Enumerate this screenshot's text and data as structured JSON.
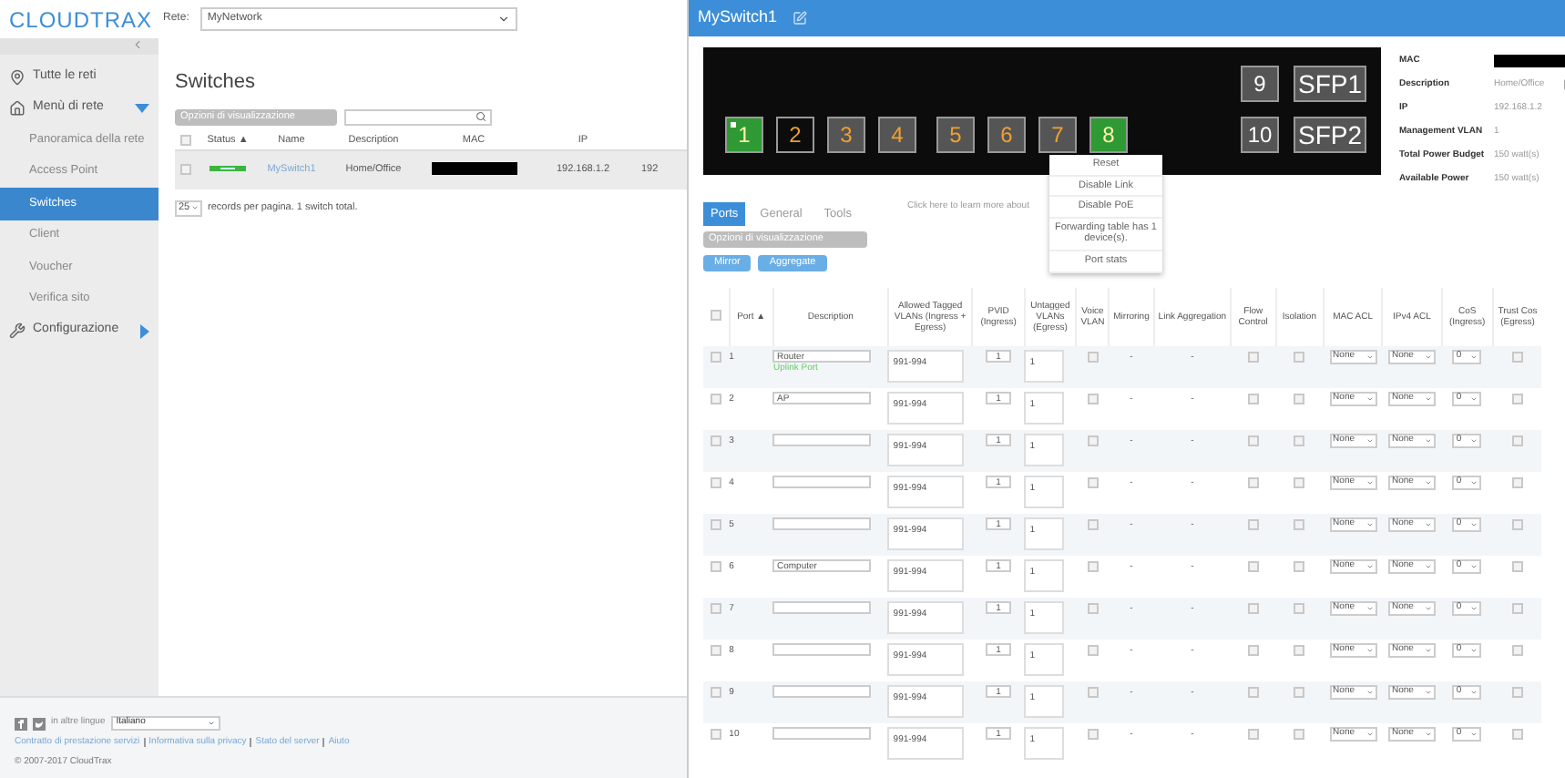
{
  "topbar": {
    "logo": "CLOUDTRAX",
    "network_label": "Rete:",
    "network": "MyNetwork"
  },
  "sidebar": {
    "items": [
      {
        "label": "Tutte le reti",
        "kind": "pin",
        "selected": false
      },
      {
        "label": "Menù di rete",
        "kind": "home",
        "expanded": true,
        "selected": false,
        "children": [
          {
            "label": "Panoramica della rete",
            "selected": false
          },
          {
            "label": "Access Point",
            "selected": false
          },
          {
            "label": "Switches",
            "selected": true
          },
          {
            "label": "Client",
            "selected": false
          },
          {
            "label": "Voucher",
            "selected": false
          },
          {
            "label": "Verifica sito",
            "selected": false
          }
        ]
      },
      {
        "label": "Configurazione",
        "kind": "wrench",
        "expanded": false,
        "selected": false
      }
    ]
  },
  "switches": {
    "title": "Switches",
    "options_button": "Opzioni di visualizzazione",
    "columns": [
      "Status ▲",
      "Name",
      "Description",
      "MAC",
      "IP"
    ],
    "all_checked": false,
    "rows": [
      {
        "checked": false,
        "name": "MySwitch1",
        "description": "Home/Office",
        "ip": "192.168.1.2",
        "column_6": "192"
      }
    ],
    "page_size": "25",
    "pager_text": "records per pagina. 1 switch total."
  },
  "footer": {
    "language_label": "in altre lingue",
    "language": "Italiano",
    "links": [
      "Contratto di prestazione servizi",
      "Informativa sulla privacy",
      "Stato del server",
      "Aiuto"
    ],
    "copyright": "© 2007-2017 CloudTrax"
  },
  "panel": {
    "title": "MySwitch1",
    "ports": [
      {
        "label": "1",
        "kind": "connected",
        "poe": true,
        "indicator": true
      },
      {
        "label": "2",
        "kind": "empty",
        "poe": true,
        "indicator": false
      },
      {
        "label": "3",
        "kind": "idle",
        "poe": true,
        "indicator": false
      },
      {
        "label": "4",
        "kind": "idle",
        "poe": true,
        "indicator": false
      },
      {
        "label": "5",
        "kind": "idle",
        "poe": true,
        "indicator": false
      },
      {
        "label": "6",
        "kind": "idle",
        "poe": true,
        "indicator": false
      },
      {
        "label": "7",
        "kind": "idle",
        "poe": true,
        "indicator": false
      },
      {
        "label": "8",
        "kind": "connected",
        "poe": true,
        "indicator": false
      }
    ],
    "upper_ports": [
      {
        "label": "9",
        "kind": "idle",
        "poe": false,
        "indicator": false
      },
      {
        "label": "SFP1",
        "kind": "idle",
        "poe": false,
        "indicator": false
      }
    ],
    "lower_ports": [
      {
        "label": "10",
        "kind": "idle",
        "poe": false,
        "indicator": false
      },
      {
        "label": "SFP2",
        "kind": "idle",
        "poe": false,
        "indicator": false
      }
    ],
    "learn_more": "Click here to learn more about",
    "context_menu": [
      "Reset",
      "Disable Link",
      "Disable PoE",
      "Forwarding table has 1 device(s).",
      "Port stats"
    ],
    "info": [
      {
        "label": "MAC",
        "kind": "redacted"
      },
      {
        "label": "Description",
        "value": "Home/Office",
        "kind": "editable"
      },
      {
        "label": "IP",
        "value": "192.168.1.2",
        "kind": "text"
      },
      {
        "label": "Management VLAN",
        "value": "1",
        "kind": "text"
      },
      {
        "label": "Total Power Budget",
        "value": "150 watt(s)",
        "kind": "text"
      },
      {
        "label": "Available Power",
        "value": "150 watt(s)",
        "kind": "text"
      }
    ],
    "tabs": [
      {
        "label": "Ports",
        "selected": true
      },
      {
        "label": "General",
        "selected": false
      },
      {
        "label": "Tools",
        "selected": false
      }
    ],
    "options_button": "Opzioni di visualizzazione",
    "buttons": [
      "Mirror",
      "Aggregate"
    ],
    "all_checked": false,
    "columns": [
      "Port ▲",
      "Description",
      "Allowed Tagged VLANs (Ingress + Egress)",
      "PVID (Ingress)",
      "Untagged VLANs (Egress)",
      "Voice VLAN",
      "Mirroring",
      "Link Aggregation",
      "Flow Control",
      "Isolation",
      "MAC ACL",
      "IPv4 ACL",
      "CoS (Ingress)",
      "Trust Cos (Egress)"
    ],
    "rows": [
      {
        "port": "1",
        "description": "Router",
        "note": "Uplink Port",
        "tagged": "991-994",
        "pvid": "1",
        "untagged": "1",
        "mirroring": "-",
        "link_aggregation": "-",
        "mac_acl": "None",
        "ipv4_acl": "None",
        "cos": "0",
        "checked": false,
        "voice_vlan": false,
        "flow_control": false,
        "isolation": false,
        "trust_cos": false
      },
      {
        "port": "2",
        "description": "AP",
        "tagged": "991-994",
        "pvid": "1",
        "untagged": "1",
        "mirroring": "-",
        "link_aggregation": "-",
        "mac_acl": "None",
        "ipv4_acl": "None",
        "cos": "0",
        "checked": false,
        "voice_vlan": false,
        "flow_control": false,
        "isolation": false,
        "trust_cos": false
      },
      {
        "port": "3",
        "tagged": "991-994",
        "pvid": "1",
        "untagged": "1",
        "mirroring": "-",
        "link_aggregation": "-",
        "mac_acl": "None",
        "ipv4_acl": "None",
        "cos": "0",
        "checked": false,
        "voice_vlan": false,
        "flow_control": false,
        "isolation": false,
        "trust_cos": false
      },
      {
        "port": "4",
        "tagged": "991-994",
        "pvid": "1",
        "untagged": "1",
        "mirroring": "-",
        "link_aggregation": "-",
        "mac_acl": "None",
        "ipv4_acl": "None",
        "cos": "0",
        "checked": false,
        "voice_vlan": false,
        "flow_control": false,
        "isolation": false,
        "trust_cos": false
      },
      {
        "port": "5",
        "tagged": "991-994",
        "pvid": "1",
        "untagged": "1",
        "mirroring": "-",
        "link_aggregation": "-",
        "mac_acl": "None",
        "ipv4_acl": "None",
        "cos": "0",
        "checked": false,
        "voice_vlan": false,
        "flow_control": false,
        "isolation": false,
        "trust_cos": false
      },
      {
        "port": "6",
        "description": "Computer",
        "tagged": "991-994",
        "pvid": "1",
        "untagged": "1",
        "mirroring": "-",
        "link_aggregation": "-",
        "mac_acl": "None",
        "ipv4_acl": "None",
        "cos": "0",
        "checked": false,
        "voice_vlan": false,
        "flow_control": false,
        "isolation": false,
        "trust_cos": false
      },
      {
        "port": "7",
        "tagged": "991-994",
        "pvid": "1",
        "untagged": "1",
        "mirroring": "-",
        "link_aggregation": "-",
        "mac_acl": "None",
        "ipv4_acl": "None",
        "cos": "0",
        "checked": false,
        "voice_vlan": false,
        "flow_control": false,
        "isolation": false,
        "trust_cos": false
      },
      {
        "port": "8",
        "tagged": "991-994",
        "pvid": "1",
        "untagged": "1",
        "mirroring": "-",
        "link_aggregation": "-",
        "mac_acl": "None",
        "ipv4_acl": "None",
        "cos": "0",
        "checked": false,
        "voice_vlan": false,
        "flow_control": false,
        "isolation": false,
        "trust_cos": false
      },
      {
        "port": "9",
        "tagged": "991-994",
        "pvid": "1",
        "untagged": "1",
        "mirroring": "-",
        "link_aggregation": "-",
        "mac_acl": "None",
        "ipv4_acl": "None",
        "cos": "0",
        "checked": false,
        "voice_vlan": false,
        "flow_control": false,
        "isolation": false,
        "trust_cos": false
      },
      {
        "port": "10",
        "tagged": "991-994",
        "pvid": "1",
        "untagged": "1",
        "mirroring": "-",
        "link_aggregation": "-",
        "mac_acl": "None",
        "ipv4_acl": "None",
        "cos": "0",
        "checked": false,
        "voice_vlan": false,
        "flow_control": false,
        "isolation": false,
        "trust_cos": false
      }
    ]
  }
}
